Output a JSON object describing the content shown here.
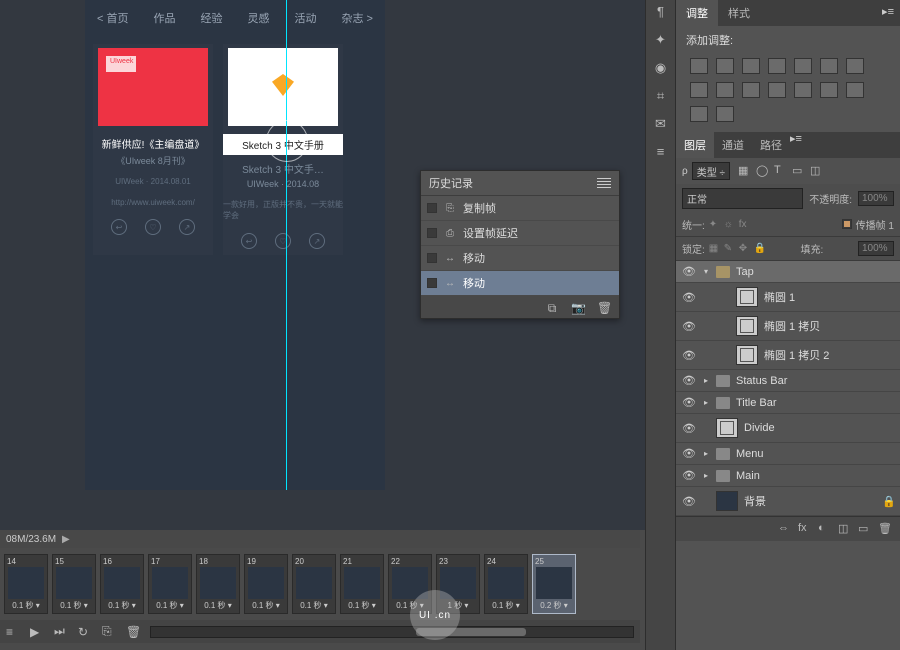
{
  "app_mock": {
    "nav": [
      "< 首页",
      "作品",
      "经验",
      "灵感",
      "活动",
      "杂志 >"
    ],
    "cards": [
      {
        "title": "新鲜供应!《主编盘道》",
        "sub": "《UIweek 8月刊》",
        "meta": "UIWeek · 2014.08.01",
        "link": "http://www.uiweek.com/"
      },
      {
        "caption": "Sketch 3 中文手册",
        "title": "Sketch 3 中文手…",
        "sub": "UIWeek · 2014.08",
        "meta": "一款好用，正版并不贵，一天就能学会"
      }
    ]
  },
  "history": {
    "title": "历史记录",
    "items": [
      {
        "label": "复制帧",
        "icon": "⎘"
      },
      {
        "label": "设置帧延迟",
        "icon": "⎙"
      },
      {
        "label": "移动",
        "icon": "↔"
      },
      {
        "label": "移动",
        "icon": "↔",
        "active": true
      }
    ],
    "footer_icons": [
      "⧉",
      "📷",
      "🗑"
    ]
  },
  "adjust_panel": {
    "tabs": [
      "调整",
      "样式"
    ],
    "title": "添加调整:",
    "icons_count": 16
  },
  "layers_panel": {
    "tabs": [
      "图层",
      "通道",
      "路径"
    ],
    "filter_label": "类型",
    "filter_icons": [
      "▦",
      "◯",
      "T",
      "▭",
      "◫"
    ],
    "blend_mode": "正常",
    "opacity_label": "不透明度:",
    "opacity_value": "100%",
    "unify_label": "统一:",
    "unify_icons": [
      "✦",
      "☼",
      "fx"
    ],
    "propagate_label": "传播帧 1",
    "lock_label": "锁定:",
    "lock_icons": [
      "▦",
      "✎",
      "✥",
      "🔒"
    ],
    "fill_label": "填充:",
    "fill_value": "100%",
    "layers": [
      {
        "type": "folder-open",
        "name": "Tap",
        "sel": true
      },
      {
        "type": "shape",
        "name": "椭圆 1",
        "indent": 1
      },
      {
        "type": "shape",
        "name": "椭圆 1 拷贝",
        "indent": 1
      },
      {
        "type": "shape",
        "name": "椭圆 1 拷贝 2",
        "indent": 1
      },
      {
        "type": "folder",
        "name": "Status Bar"
      },
      {
        "type": "folder",
        "name": "Title Bar"
      },
      {
        "type": "shape",
        "name": "Divide"
      },
      {
        "type": "folder",
        "name": "Menu"
      },
      {
        "type": "folder",
        "name": "Main"
      },
      {
        "type": "bg",
        "name": "背景",
        "locked": true
      }
    ],
    "footer_icons": [
      "⇔",
      "fx",
      "◐",
      "◫",
      "▭",
      "🗑"
    ]
  },
  "dock_icons": [
    "¶",
    "✦",
    "◉",
    "⌗",
    "✉",
    "≡"
  ],
  "status_bar": {
    "text": "08M/23.6M"
  },
  "timeline": {
    "frames": [
      {
        "n": 14,
        "d": "0.1 秒"
      },
      {
        "n": 15,
        "d": "0.1 秒"
      },
      {
        "n": 16,
        "d": "0.1 秒"
      },
      {
        "n": 17,
        "d": "0.1 秒"
      },
      {
        "n": 18,
        "d": "0.1 秒"
      },
      {
        "n": 19,
        "d": "0.1 秒"
      },
      {
        "n": 20,
        "d": "0.1 秒"
      },
      {
        "n": 21,
        "d": "0.1 秒"
      },
      {
        "n": 22,
        "d": "0.1 秒"
      },
      {
        "n": 23,
        "d": "1 秒"
      },
      {
        "n": 24,
        "d": "0.1 秒"
      },
      {
        "n": 25,
        "d": "0.2 秒",
        "sel": true
      }
    ],
    "controls": [
      "≡",
      "▶",
      "⏭",
      "↻",
      "⎘",
      "🗑"
    ]
  },
  "watermark": "UI .cn"
}
